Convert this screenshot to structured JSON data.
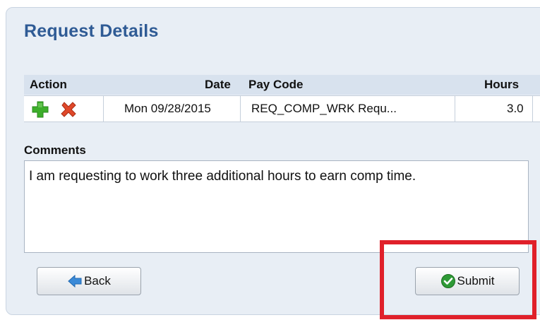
{
  "title": "Request Details",
  "grid": {
    "columns": [
      "Action",
      "Date",
      "Pay Code",
      "Hours"
    ],
    "rows": [
      {
        "date": "Mon 09/28/2015",
        "pay_code": "REQ_COMP_WRK Requ...",
        "hours": "3.0"
      }
    ]
  },
  "comments": {
    "label": "Comments",
    "value": "I am requesting to work three additional hours to earn comp time."
  },
  "buttons": {
    "back": "Back",
    "submit": "Submit"
  },
  "colors": {
    "title": "#2f5b95",
    "panel": "#e8eef5",
    "highlight": "#e0202a",
    "add_icon": "#3dae2b",
    "delete_icon": "#e0482a"
  }
}
